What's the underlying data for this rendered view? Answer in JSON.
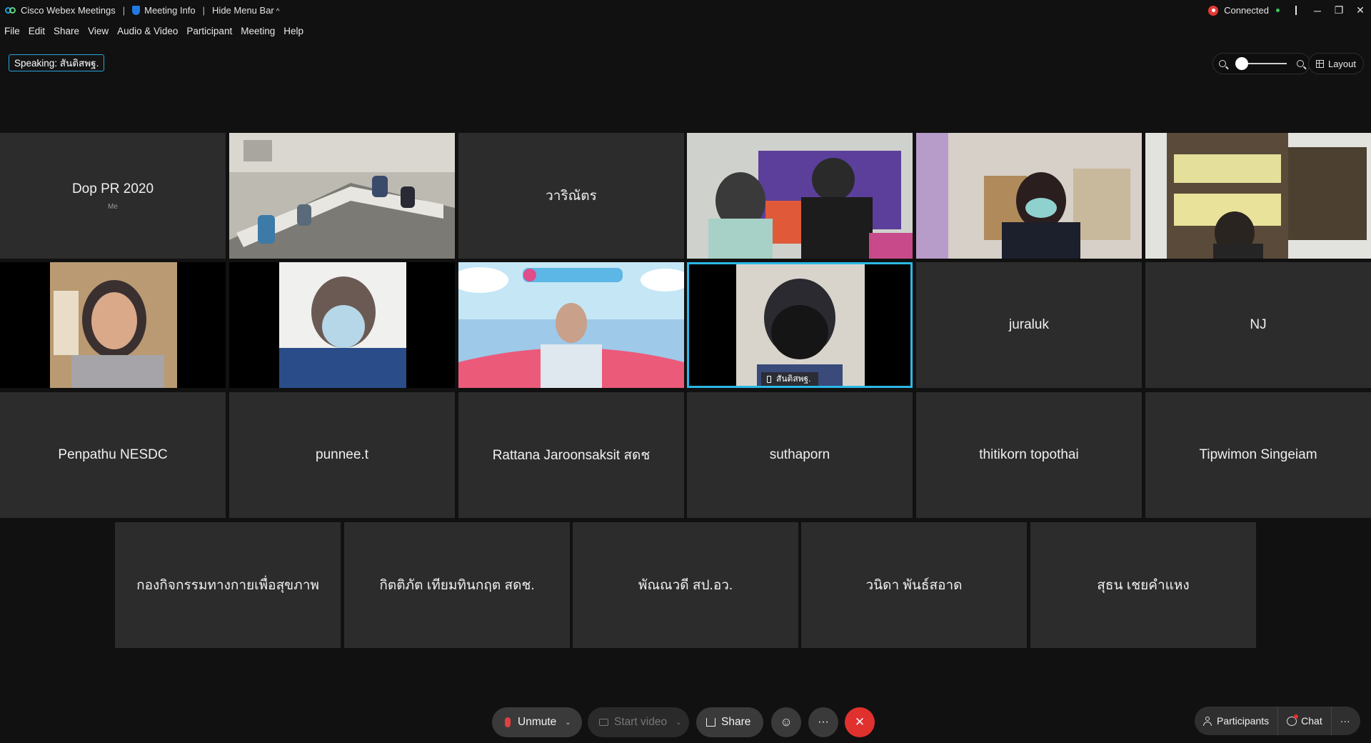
{
  "titlebar": {
    "app_title": "Cisco Webex Meetings",
    "meeting_info": "Meeting Info",
    "hide_menu": "Hide Menu Bar",
    "status": "Connected"
  },
  "menu": [
    "File",
    "Edit",
    "Share",
    "View",
    "Audio & Video",
    "Participant",
    "Meeting",
    "Help"
  ],
  "speaking": "Speaking: สันติสพฐ.",
  "layout_label": "Layout",
  "tiles": {
    "t1": {
      "name": "Dop PR 2020",
      "sub": "Me"
    },
    "t3": {
      "name": "วาริณัตร"
    },
    "t11": {
      "name": "juraluk"
    },
    "t12": {
      "name": "NJ"
    },
    "t13": {
      "name": "Penpathu NESDC"
    },
    "t14": {
      "name": "punnee.t"
    },
    "t15": {
      "name": "Rattana Jaroonsaksit สดช"
    },
    "t16": {
      "name": "suthaporn"
    },
    "t17": {
      "name": "thitikorn topothai"
    },
    "t18": {
      "name": "Tipwimon Singeiam"
    },
    "t19": {
      "name": "กองกิจกรรมทางกายเพื่อสุขภาพ"
    },
    "t20": {
      "name": "กิตติภัต เทียมทินกฤต สดช."
    },
    "t21": {
      "name": "พัณณวดี สป.อว."
    },
    "t22": {
      "name": "วนิดา พันธ์สอาด"
    },
    "t23": {
      "name": "สุธน เชยคำแหง"
    },
    "active_speaker_tag": "สันติสพฐ."
  },
  "controls": {
    "unmute": "Unmute",
    "start_video": "Start video",
    "share": "Share",
    "participants": "Participants",
    "chat": "Chat",
    "more": "···"
  },
  "colors": {
    "background": "#111111",
    "tile": "#2c2c2c",
    "accent": "#2bb8e6",
    "end_call": "#e0312f"
  }
}
